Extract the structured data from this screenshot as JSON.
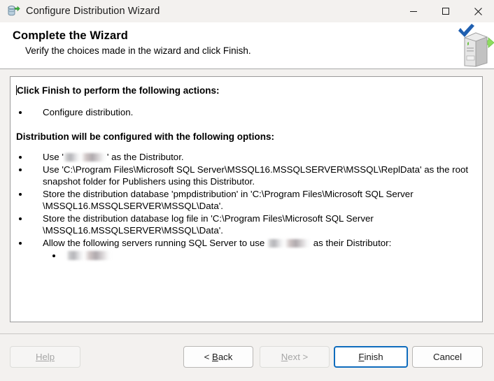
{
  "window": {
    "title": "Configure Distribution Wizard",
    "app_icon": "replication-database-icon",
    "controls": {
      "minimize": "minimize-icon",
      "maximize": "maximize-icon",
      "close": "close-icon"
    }
  },
  "header": {
    "title": "Complete the Wizard",
    "subtitle": "Verify the choices made in the wizard and click Finish.",
    "art": "server-with-checkmark-icon"
  },
  "content": {
    "heading_actions": "Click Finish to perform the following actions:",
    "actions": [
      "Configure distribution."
    ],
    "heading_options": "Distribution will be configured with the following options:",
    "options": [
      {
        "prefix": "Use '",
        "redacted": true,
        "suffix": "' as the Distributor."
      },
      {
        "text": "Use 'C:\\Program Files\\Microsoft SQL Server\\MSSQL16.MSSQLSERVER\\MSSQL\\ReplData' as the root snapshot folder for Publishers using this Distributor."
      },
      {
        "text": "Store the distribution database 'pmpdistribution' in 'C:\\Program Files\\Microsoft SQL Server \\MSSQL16.MSSQLSERVER\\MSSQL\\Data'."
      },
      {
        "text": "Store the distribution database log file in 'C:\\Program Files\\Microsoft SQL Server \\MSSQL16.MSSQLSERVER\\MSSQL\\Data'."
      },
      {
        "prefix": "Allow the following servers running SQL Server to use ",
        "redacted": true,
        "suffix": " as their Distributor:",
        "sub_items_redacted": 1
      }
    ]
  },
  "footer": {
    "help_label": "Help",
    "back_label": "< Back",
    "back_mnemonic": "B",
    "next_label": "Next >",
    "next_mnemonic": "N",
    "finish_label": "Finish",
    "finish_mnemonic": "F",
    "cancel_label": "Cancel"
  },
  "colors": {
    "accent": "#0f6cbd",
    "window_bg": "#f3f1ef",
    "panel_bg": "#ffffff",
    "disabled_text": "#a6a6a6",
    "checkmark": "#1f5fb0",
    "arrow_green": "#78d44a"
  }
}
